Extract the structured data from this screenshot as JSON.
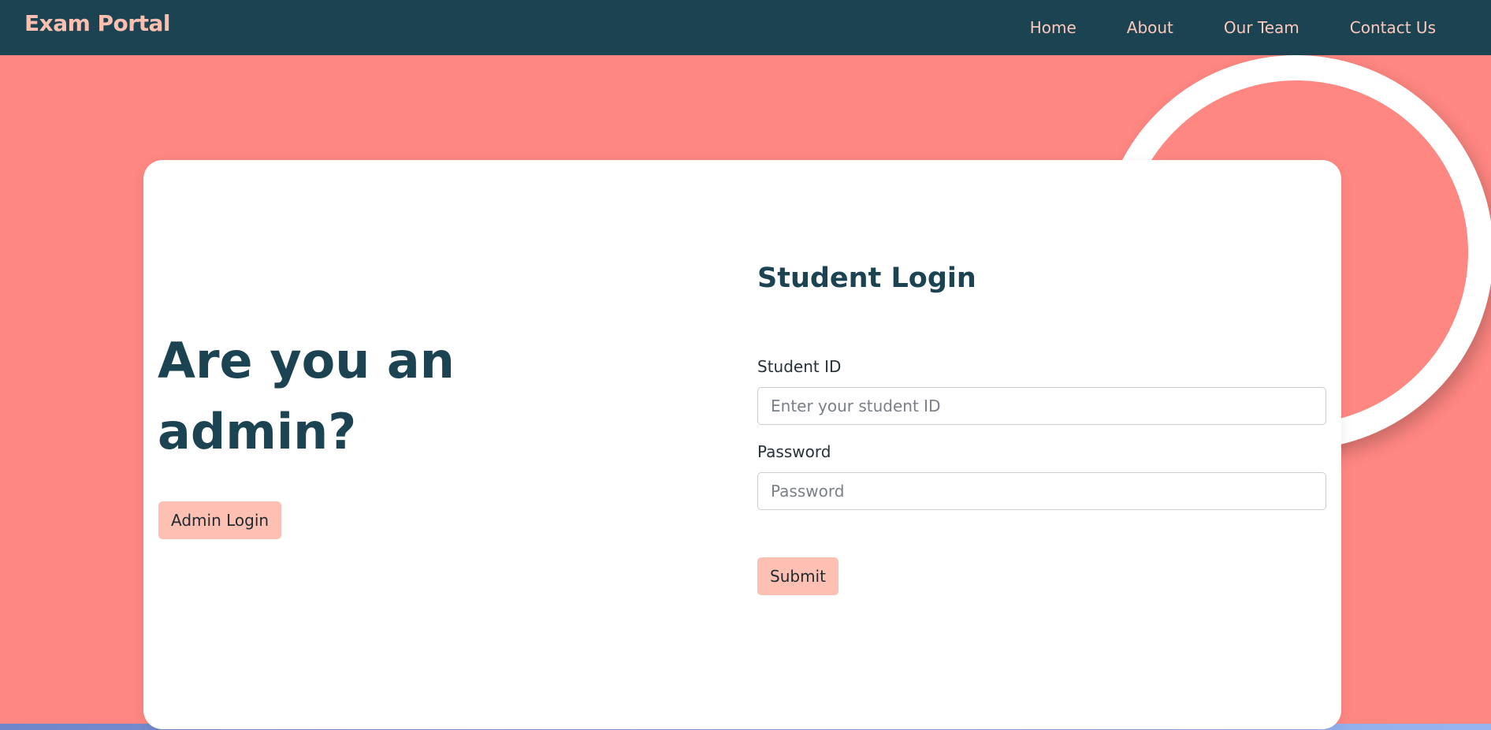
{
  "navbar": {
    "brand": "Exam Portal",
    "links": [
      "Home",
      "About",
      "Our Team",
      "Contact Us"
    ]
  },
  "admin": {
    "heading": "Are you an admin?",
    "button_label": "Admin Login"
  },
  "login": {
    "title": "Student Login",
    "student_id_label": "Student ID",
    "student_id_placeholder": "Enter your student ID",
    "password_label": "Password",
    "password_placeholder": "Password",
    "submit_label": "Submit"
  },
  "colors": {
    "navbar_bg": "#1b4352",
    "page_bg": "#ff8782",
    "brand": "#fdbfb0",
    "button_bg": "#fdc0b2",
    "heading": "#1b4352"
  }
}
